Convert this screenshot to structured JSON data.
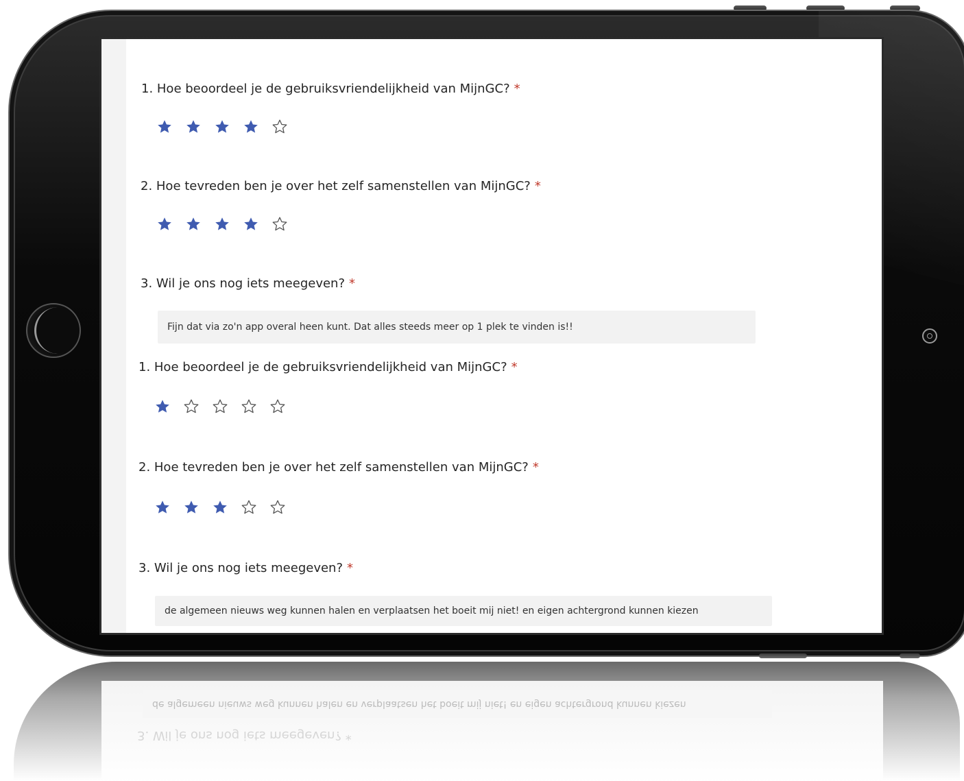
{
  "survey": {
    "responses": [
      {
        "questions": [
          {
            "label": "1. Hoe beoordeel je de gebruiksvriendelijkheid van MijnGC?",
            "required_mark": "*",
            "rating": 4,
            "max_rating": 5
          },
          {
            "label": "2. Hoe tevreden ben je over het zelf samenstellen van MijnGC?",
            "required_mark": "*",
            "rating": 4,
            "max_rating": 5
          },
          {
            "label": "3. Wil je ons nog iets meegeven?",
            "required_mark": "*",
            "answer": "Fijn dat via zo'n app overal heen kunt. Dat alles steeds meer op 1 plek te vinden is!!"
          }
        ]
      },
      {
        "questions": [
          {
            "label": "1. Hoe beoordeel je de gebruiksvriendelijkheid van MijnGC?",
            "required_mark": "*",
            "rating": 1,
            "max_rating": 5
          },
          {
            "label": "2. Hoe tevreden ben je over het zelf samenstellen van MijnGC?",
            "required_mark": "*",
            "rating": 3,
            "max_rating": 5
          },
          {
            "label": "3. Wil je ons nog iets meegeven?",
            "required_mark": "*",
            "answer": "de algemeen nieuws weg kunnen halen en verplaatsen het boeit mij niet! en eigen achtergrond kunnen kiezen"
          }
        ]
      }
    ]
  },
  "colors": {
    "star_filled": "#3f5bb0",
    "star_empty_stroke": "#555555",
    "required": "#c0392b",
    "answer_bg": "#f2f2f2"
  },
  "icons": {
    "filled": "star-filled-icon",
    "empty": "star-empty-icon"
  }
}
